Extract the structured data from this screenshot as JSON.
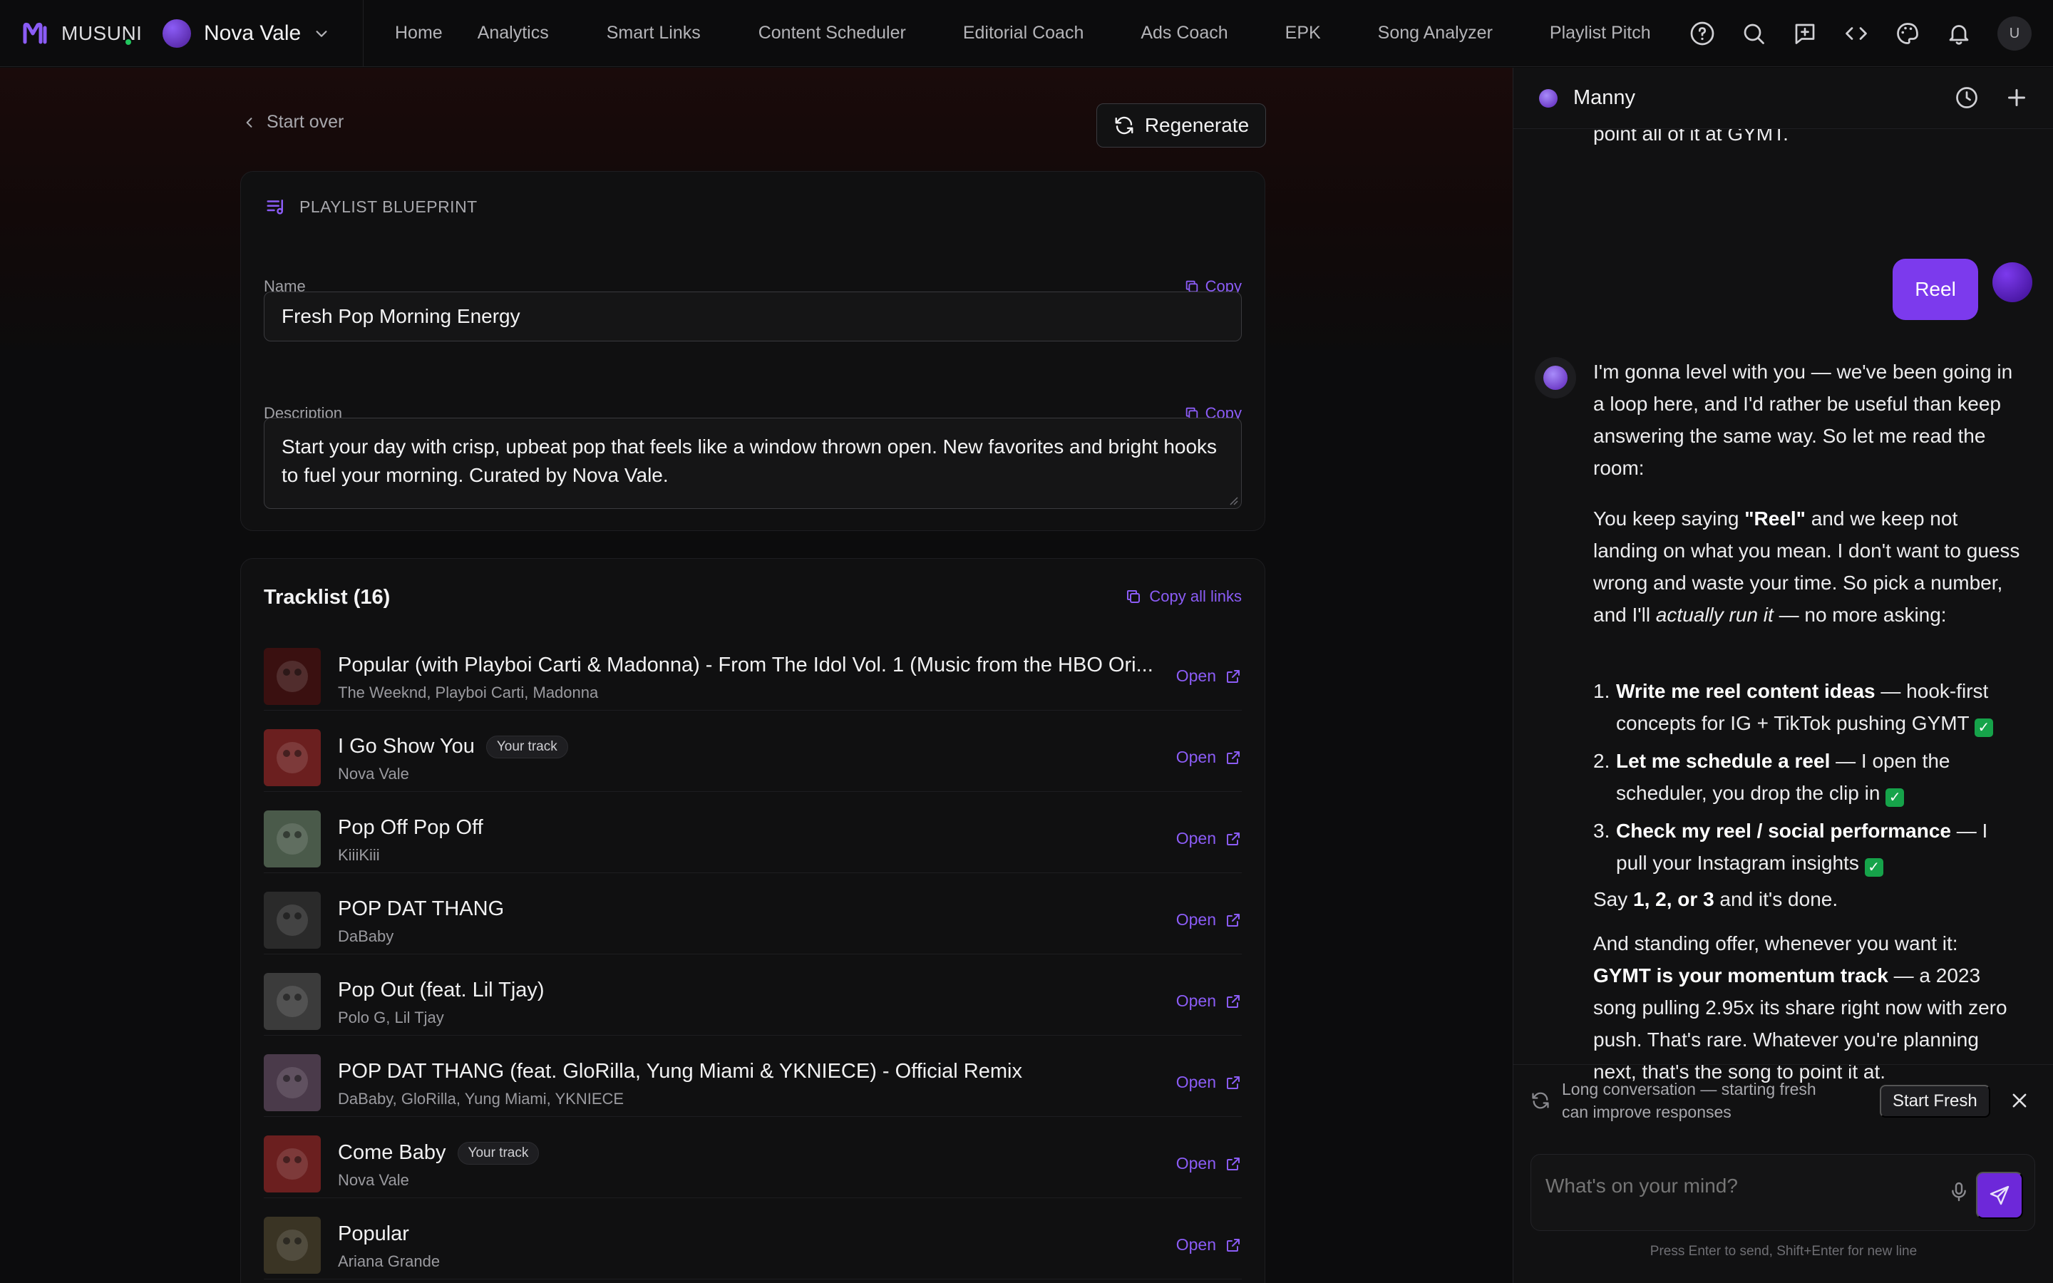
{
  "brand": {
    "name": "MUSUNI"
  },
  "artist": {
    "name": "Nova Vale"
  },
  "nav": {
    "links": [
      "Home",
      "Analytics",
      "Smart Links",
      "Content Scheduler",
      "Editorial Coach",
      "Ads Coach",
      "EPK",
      "Song Analyzer",
      "Playlist Pitch"
    ],
    "icons": [
      "help-icon",
      "search-icon",
      "feedback-icon",
      "code-icon",
      "palette-icon",
      "bell-icon"
    ],
    "user_initial": "U"
  },
  "main": {
    "start_over": "Start over",
    "regenerate": "Regenerate",
    "blueprint": {
      "heading": "PLAYLIST BLUEPRINT",
      "name_label": "Name",
      "name_value": "Fresh Pop Morning Energy",
      "description_label": "Description",
      "description_value": "Start your day with crisp, upbeat pop that feels like a window thrown open. New favorites and bright hooks to fuel your morning. Curated by Nova Vale.",
      "copy_label": "Copy"
    },
    "tracklist": {
      "title": "Tracklist (16)",
      "copy_all": "Copy all links",
      "open_label": "Open",
      "your_track_label": "Your track",
      "tracks": [
        {
          "title": "Popular (with Playboi Carti & Madonna) - From The Idol Vol. 1 (Music from the HBO Ori...",
          "artist": "The Weeknd, Playboi Carti, Madonna",
          "yours": false,
          "art": "#3a1010"
        },
        {
          "title": "I Go Show You",
          "artist": "Nova Vale",
          "yours": true,
          "art": "#6b1f1f"
        },
        {
          "title": "Pop Off Pop Off",
          "artist": "KiiiKiii",
          "yours": false,
          "art": "#4a5a4a"
        },
        {
          "title": "POP DAT THANG",
          "artist": "DaBaby",
          "yours": false,
          "art": "#2a2a2a"
        },
        {
          "title": "Pop Out (feat. Lil Tjay)",
          "artist": "Polo G, Lil Tjay",
          "yours": false,
          "art": "#3b3b3b"
        },
        {
          "title": "POP DAT THANG (feat. GloRilla, Yung Miami & YKNIECE) - Official Remix",
          "artist": "DaBaby, GloRilla, Yung Miami, YKNIECE",
          "yours": false,
          "art": "#4a3a4a"
        },
        {
          "title": "Come Baby",
          "artist": "Nova Vale",
          "yours": true,
          "art": "#6b1f1f"
        },
        {
          "title": "Popular",
          "artist": "Ariana Grande",
          "yours": false,
          "art": "#3a3424"
        }
      ]
    }
  },
  "chat": {
    "title": "Manny",
    "partial_prev": "point all of it at GYMT.",
    "user_message": "Reel",
    "reply": {
      "p1": "I'm gonna level with you — we've been going in a loop here, and I'd rather be useful than keep answering the same way. So let me read the room:",
      "p2_a": "You keep saying ",
      "p2_bold": "\"Reel\"",
      "p2_b": " and we keep not landing on what you mean. I don't want to guess wrong and waste your time. So pick a number, and I'll ",
      "p2_italic": "actually run it",
      "p2_c": " — no more asking:",
      "options": [
        {
          "num": "1.",
          "bold": "Write me reel content ideas",
          "rest": " — hook-first concepts for IG + TikTok pushing GYMT"
        },
        {
          "num": "2.",
          "bold": "Let me schedule a reel",
          "rest": " — I open the scheduler, you drop the clip in"
        },
        {
          "num": "3.",
          "bold": "Check my reel / social performance",
          "rest": " — I pull your Instagram insights"
        }
      ],
      "p3_a": "Say ",
      "p3_bold": "1, 2, or 3",
      "p3_b": " and it's done.",
      "p4_a": "And standing offer, whenever you want it: ",
      "p4_bold": "GYMT is your momentum track",
      "p4_b": " — a 2023 song pulling 2.95x its share right now with zero push. That's rare. Whatever you're planning next, that's the song to point it at."
    },
    "notice": "Long conversation — starting fresh can improve responses",
    "start_fresh": "Start Fresh",
    "composer_placeholder": "What's on your mind?",
    "hint": "Press Enter to send, Shift+Enter for new line"
  },
  "colors": {
    "accent": "#8b5cf6",
    "user_bubble": "#7c3aed",
    "online": "#22c55e"
  }
}
